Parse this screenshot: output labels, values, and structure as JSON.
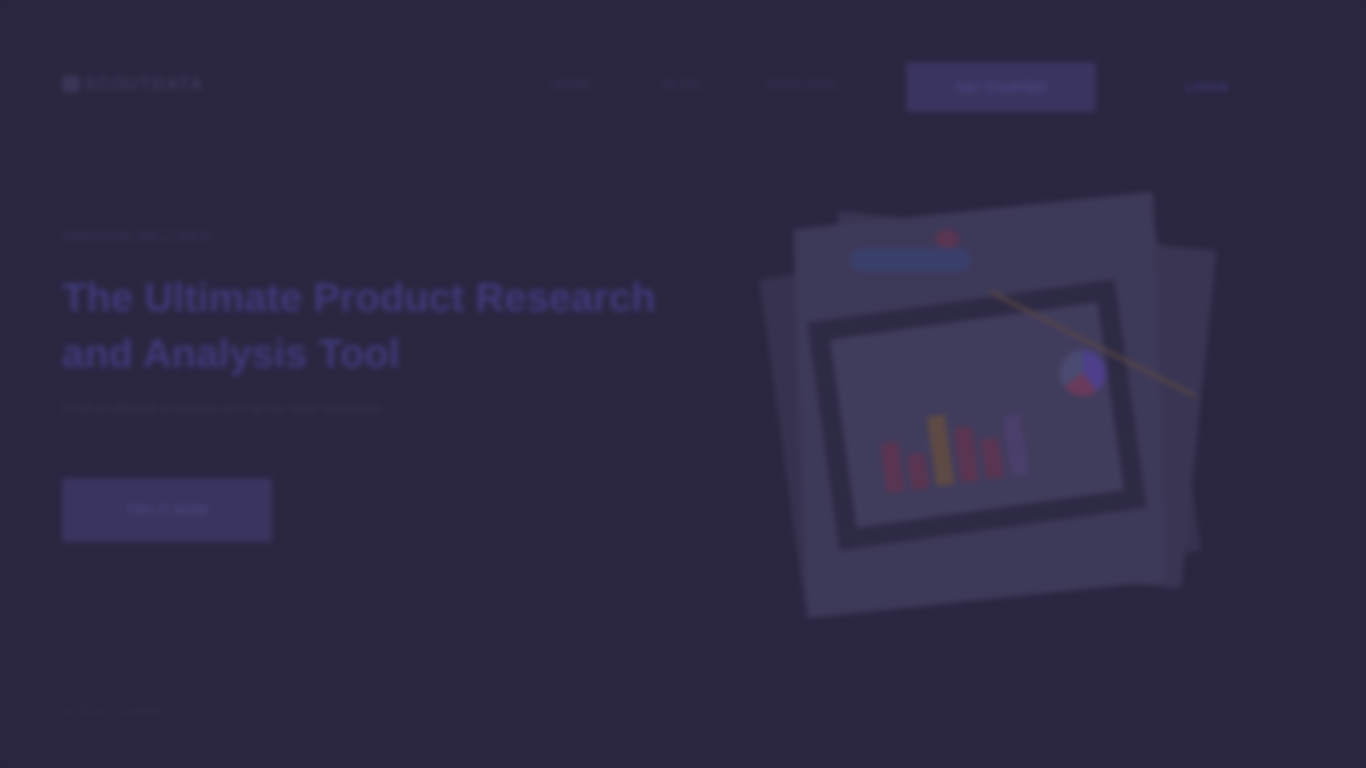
{
  "header": {
    "logo_text": "SCOUTDATA",
    "nav": [
      "HOME",
      "BLOG",
      "FEATURES"
    ],
    "cta_label": "GET STARTED",
    "login_label": "LOGIN"
  },
  "hero": {
    "eyebrow": "AMAZON SELLERS",
    "title": "The Ultimate Product Research and Analysis Tool",
    "subtitle": "Find profitable products and grow your business",
    "cta_label": "TRY IT NOW"
  },
  "footer_hint": "SCROLL DOWN",
  "colors": {
    "background": "#2a2640",
    "accent": "#3f3a7a",
    "button": "#3a3460"
  },
  "overlay": "dimmed"
}
